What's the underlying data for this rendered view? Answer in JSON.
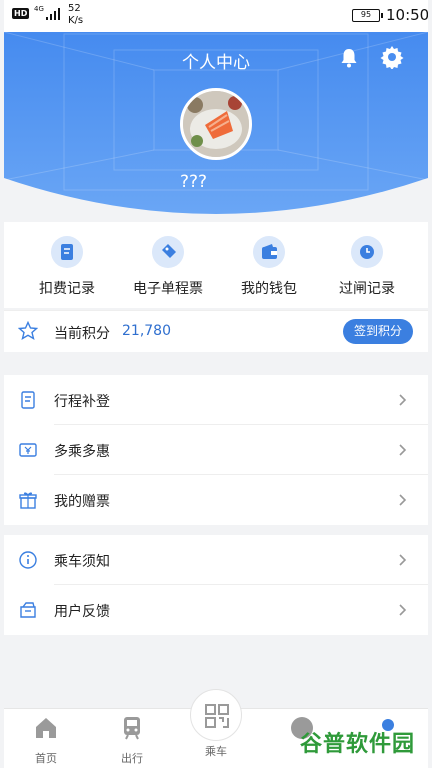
{
  "status_bar": {
    "hd": "HD",
    "network": "4G",
    "speed_value": "52",
    "speed_unit": "K/s",
    "battery": "95",
    "time": "10:50"
  },
  "header": {
    "title": "个人中心",
    "username": "???"
  },
  "quick_actions": [
    {
      "label": "扣费记录",
      "icon": "receipt-icon"
    },
    {
      "label": "电子单程票",
      "icon": "ticket-icon"
    },
    {
      "label": "我的钱包",
      "icon": "wallet-icon"
    },
    {
      "label": "过闸记录",
      "icon": "clock-icon"
    }
  ],
  "points": {
    "label": "当前积分",
    "value": "21,780",
    "button": "签到积分"
  },
  "menu_group_1": [
    {
      "label": "行程补登",
      "icon": "document-icon"
    },
    {
      "label": "多乘多惠",
      "icon": "coupon-icon"
    },
    {
      "label": "我的赠票",
      "icon": "gift-icon"
    }
  ],
  "menu_group_2": [
    {
      "label": "乘车须知",
      "icon": "info-icon"
    },
    {
      "label": "用户反馈",
      "icon": "feedback-icon"
    }
  ],
  "tabs": [
    {
      "label": "首页",
      "icon": "home-icon"
    },
    {
      "label": "出行",
      "icon": "train-icon"
    },
    {
      "label": "乘车",
      "icon": "qr-code-icon"
    },
    {
      "label": "",
      "icon": "avatar-icon"
    },
    {
      "label": "",
      "icon": "profile-icon"
    }
  ],
  "watermark": "谷普软件园",
  "colors": {
    "accent": "#3b7fe0",
    "header_blue": "#4a8ef0"
  }
}
